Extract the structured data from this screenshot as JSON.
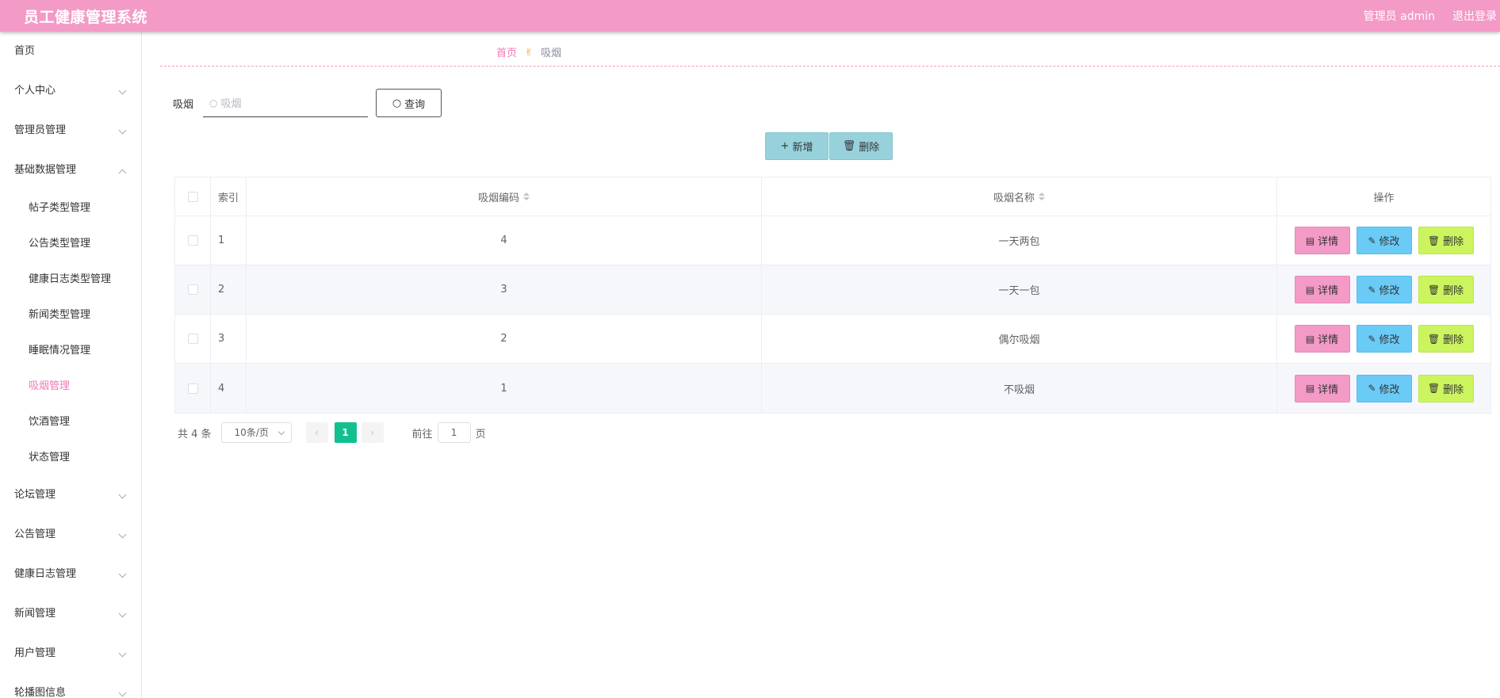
{
  "header": {
    "title": "员工健康管理系统",
    "user": "管理员 admin",
    "logout": "退出登录"
  },
  "colors": {
    "primary": "#f39ac7",
    "active_text": "#f178b6",
    "detail": "#f39ac7",
    "edit": "#6acbf7",
    "delete": "#ccf45f",
    "page_active": "#12c08f",
    "action": "#97d2dc"
  },
  "sidebar": {
    "home": "首页",
    "personal": "个人中心",
    "admin_mgmt": "管理员管理",
    "basic_data": "基础数据管理",
    "basic_children": [
      {
        "label": "帖子类型管理"
      },
      {
        "label": "公告类型管理"
      },
      {
        "label": "健康日志类型管理"
      },
      {
        "label": "新闻类型管理"
      },
      {
        "label": "睡眠情况管理"
      },
      {
        "label": "吸烟管理"
      },
      {
        "label": "饮酒管理"
      },
      {
        "label": "状态管理"
      }
    ],
    "forum": "论坛管理",
    "notice": "公告管理",
    "health_log": "健康日志管理",
    "news": "新闻管理",
    "users": "用户管理",
    "carousel": "轮播图信息"
  },
  "breadcrumb": {
    "home": "首页",
    "current": "吸烟"
  },
  "search": {
    "label": "吸烟",
    "placeholder": "吸烟",
    "button": "查询"
  },
  "actions": {
    "add": "新增",
    "delete": "删除"
  },
  "table": {
    "columns": {
      "index": "索引",
      "code": "吸烟编码",
      "name": "吸烟名称",
      "ops": "操作"
    },
    "rows": [
      {
        "index": "1",
        "code": "4",
        "name": "一天两包"
      },
      {
        "index": "2",
        "code": "3",
        "name": "一天一包"
      },
      {
        "index": "3",
        "code": "2",
        "name": "偶尔吸烟"
      },
      {
        "index": "4",
        "code": "1",
        "name": "不吸烟"
      }
    ],
    "op_labels": {
      "detail": "详情",
      "edit": "修改",
      "delete": "删除"
    }
  },
  "pagination": {
    "total": "共 4 条",
    "size": "10条/页",
    "current": "1",
    "goto_label": "前往",
    "goto_value": "1",
    "page_suffix": "页"
  }
}
